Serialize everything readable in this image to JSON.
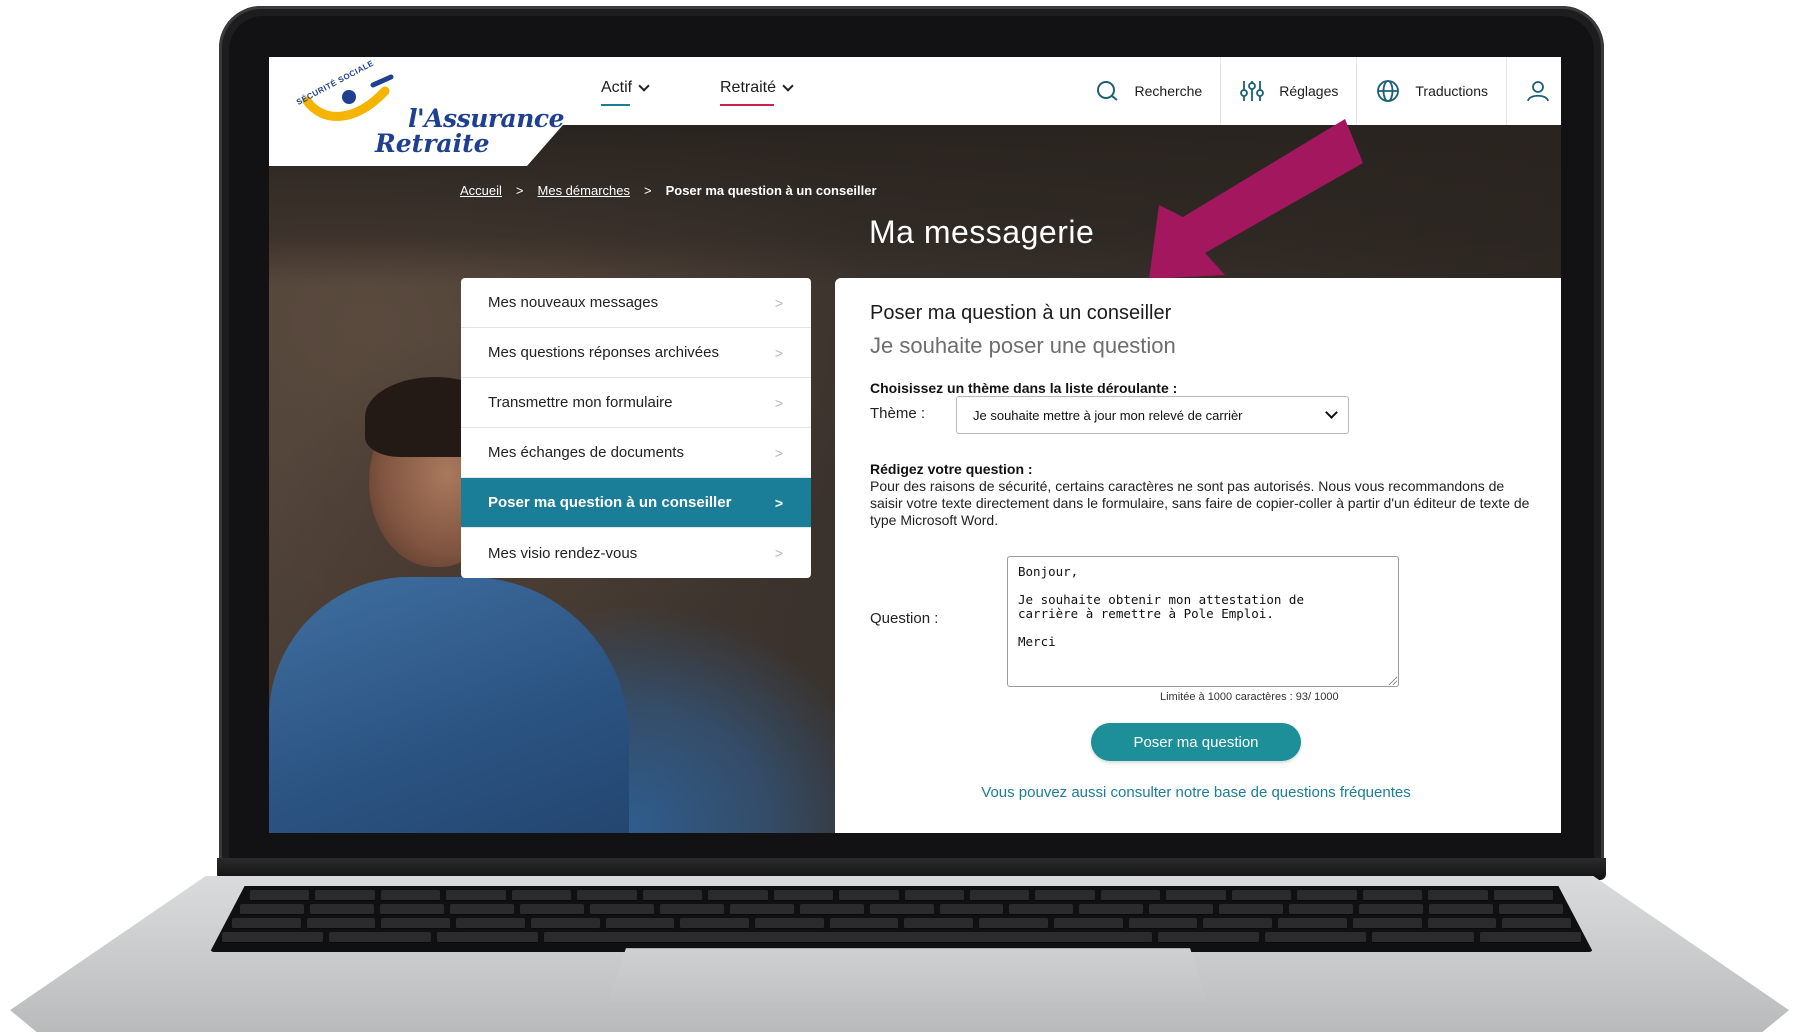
{
  "header": {
    "logo_arc_text": "SÉCURITÉ SOCIALE",
    "logo_line1": "l'Assurance",
    "logo_line2": "Retraite",
    "nav": [
      {
        "label": "Actif",
        "underline_color": "#1b7e98"
      },
      {
        "label": "Retraité",
        "underline_color": "#c8234a"
      }
    ],
    "tools": [
      {
        "label": "Recherche",
        "icon": "search-icon"
      },
      {
        "label": "Réglages",
        "icon": "sliders-icon"
      },
      {
        "label": "Traductions",
        "icon": "globe-icon"
      },
      {
        "label": "",
        "icon": "user-icon"
      }
    ]
  },
  "breadcrumb": {
    "home": "Accueil",
    "step": "Mes démarches",
    "current": "Poser ma question à un conseiller",
    "separator": ">"
  },
  "page_title": "Ma messagerie",
  "annotation": {
    "icon": "arrow-pointer-icon",
    "color": "#a3175f"
  },
  "side_menu": {
    "items": [
      {
        "label": "Mes nouveaux messages",
        "active": false
      },
      {
        "label": "Mes questions réponses archivées",
        "active": false
      },
      {
        "label": "Transmettre mon formulaire",
        "active": false
      },
      {
        "label": "Mes échanges de documents",
        "active": false
      },
      {
        "label": "Poser ma question à un conseiller",
        "active": true
      },
      {
        "label": "Mes visio rendez-vous",
        "active": false
      }
    ],
    "chevron": ">"
  },
  "form": {
    "title": "Poser ma question à un conseiller",
    "subtitle": "Je souhaite poser une question",
    "theme_instruction": "Choisissez un thème dans la liste déroulante :",
    "theme_label": "Thème :",
    "theme_selected": "Je souhaite mettre à jour mon relevé de carrièr",
    "write_label": "Rédigez votre question :",
    "write_note": "Pour des raisons de sécurité, certains caractères ne sont pas autorisés. Nous vous recommandons de saisir votre texte directement dans le formulaire, sans faire de copier-coller à partir d'un éditeur de texte de type Microsoft Word.",
    "question_label": "Question :",
    "question_value": "Bonjour,\n\nJe souhaite obtenir mon attestation de\ncarrière à remettre à Pole Emploi.\n\nMerci",
    "counter": "Limitée à 1000 caractères : 93/ 1000",
    "submit_label": "Poser ma question",
    "faq_link": "Vous pouvez aussi consulter notre base de questions fréquentes"
  },
  "colors": {
    "accent": "#1b7e98",
    "button": "#1c8f99",
    "logo_blue": "#1f3f8f",
    "logo_yellow": "#f4b400"
  }
}
